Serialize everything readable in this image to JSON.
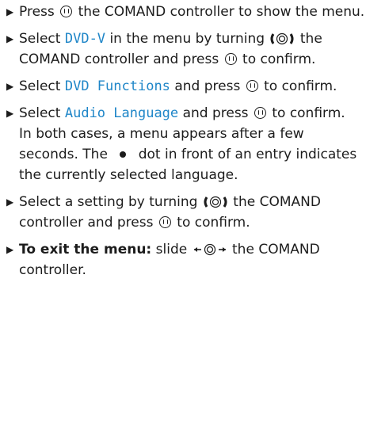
{
  "steps": [
    {
      "t1": "Press",
      "t2": "the COMAND controller to show the menu."
    },
    {
      "t1": "Select",
      "item": "DVD-V",
      "t2": "in the menu by turning",
      "t3": "the COMAND controller and press",
      "t4": "to confirm."
    },
    {
      "t1": "Select",
      "item": "DVD Functions",
      "t2": "and press",
      "t3": "to confirm."
    },
    {
      "t1": "Select",
      "item": "Audio Language",
      "t2": "and press",
      "t3": "to confirm.",
      "note_a": "In both cases, a menu appears after a few seconds. The",
      "note_b": "dot in front of an entry indicates the currently selected language."
    },
    {
      "t1": "Select a setting by turning",
      "t2": "the COMAND controller and press",
      "t3": "to confirm."
    },
    {
      "bold": "To exit the menu:",
      "t1": "slide",
      "t2": "the COMAND controller."
    }
  ],
  "icons": {
    "bullet": "triangle-right-icon",
    "press": "controller-press-icon",
    "turn": "controller-turn-icon",
    "slide": "controller-slide-icon",
    "dot": "dot-icon"
  },
  "colors": {
    "highlight": "#1f86c8",
    "text": "#1c1c1c"
  }
}
